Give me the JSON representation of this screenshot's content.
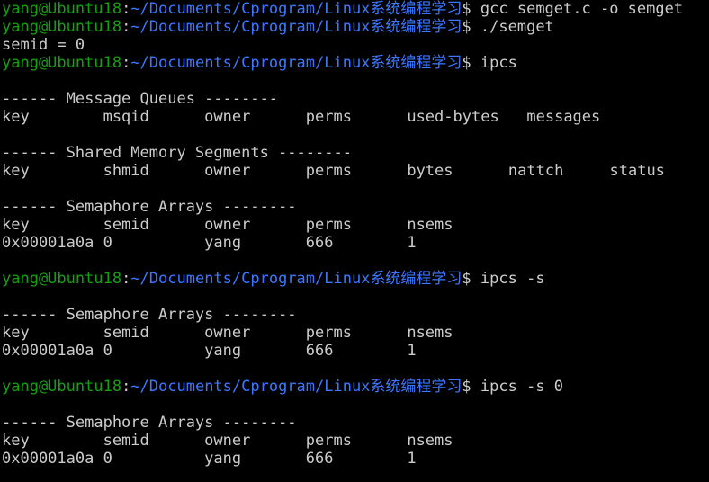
{
  "colors": {
    "background": "#000000",
    "text": "#cccccc",
    "prompt_user": "#13a10e",
    "prompt_path": "#3b78ff"
  },
  "prompt": {
    "user_host": "yang@Ubuntu18",
    "colon": ":",
    "path": "~/Documents/Cprogram/Linux系统编程学习",
    "symbol": "$ "
  },
  "lines": [
    {
      "type": "prompt",
      "command": "gcc semget.c -o semget"
    },
    {
      "type": "prompt",
      "command": "./semget"
    },
    {
      "type": "output",
      "text": "semid = 0"
    },
    {
      "type": "prompt",
      "command": "ipcs"
    },
    {
      "type": "output",
      "text": ""
    },
    {
      "type": "output",
      "text": "------ Message Queues --------"
    },
    {
      "type": "output",
      "text": "key        msqid      owner      perms      used-bytes   messages"
    },
    {
      "type": "output",
      "text": ""
    },
    {
      "type": "output",
      "text": "------ Shared Memory Segments --------"
    },
    {
      "type": "output",
      "text": "key        shmid      owner      perms      bytes      nattch     status"
    },
    {
      "type": "output",
      "text": ""
    },
    {
      "type": "output",
      "text": "------ Semaphore Arrays --------"
    },
    {
      "type": "output",
      "text": "key        semid      owner      perms      nsems"
    },
    {
      "type": "output",
      "text": "0x00001a0a 0          yang       666        1"
    },
    {
      "type": "output",
      "text": ""
    },
    {
      "type": "prompt",
      "command": "ipcs -s"
    },
    {
      "type": "output",
      "text": ""
    },
    {
      "type": "output",
      "text": "------ Semaphore Arrays --------"
    },
    {
      "type": "output",
      "text": "key        semid      owner      perms      nsems"
    },
    {
      "type": "output",
      "text": "0x00001a0a 0          yang       666        1"
    },
    {
      "type": "output",
      "text": ""
    },
    {
      "type": "prompt",
      "command": "ipcs -s 0"
    },
    {
      "type": "output",
      "text": ""
    },
    {
      "type": "output",
      "text": "------ Semaphore Arrays --------"
    },
    {
      "type": "output",
      "text": "key        semid      owner      perms      nsems"
    },
    {
      "type": "output",
      "text": "0x00001a0a 0          yang       666        1"
    }
  ]
}
